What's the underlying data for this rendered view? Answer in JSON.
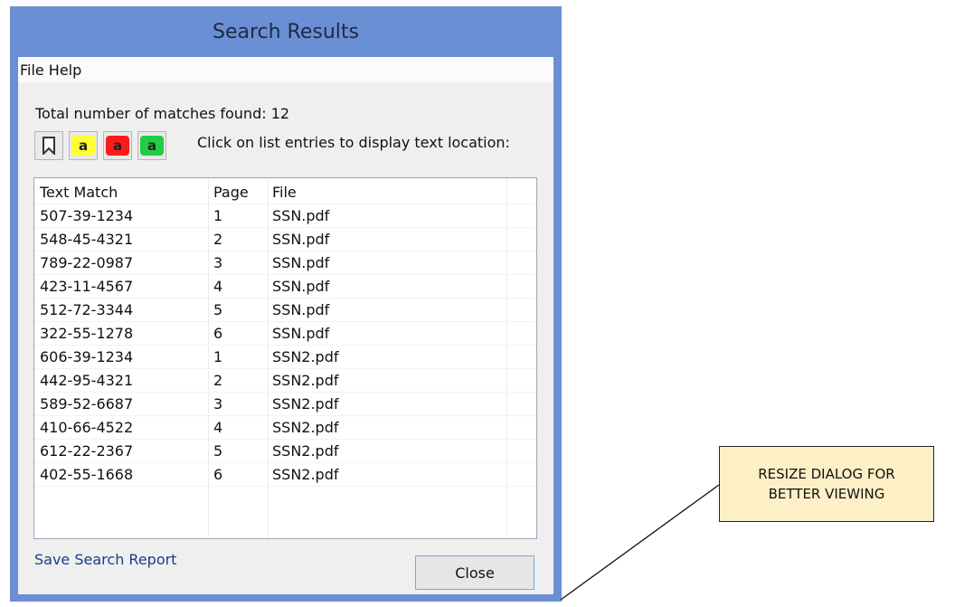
{
  "dialog": {
    "title": "Search Results",
    "menu": [
      "File",
      "Help"
    ],
    "summary": "Total number of matches found: 12",
    "hint": "Click on list entries to display text location:",
    "toolbar": {
      "highlight_letter": "a",
      "yellow": "#ffff33",
      "red": "#ff1a1a",
      "green": "#22cc44"
    },
    "columns": [
      "Text Match",
      "Page",
      "File"
    ],
    "rows": [
      [
        "507-39-1234",
        "1",
        "SSN.pdf"
      ],
      [
        "548-45-4321",
        "2",
        "SSN.pdf"
      ],
      [
        "789-22-0987",
        "3",
        "SSN.pdf"
      ],
      [
        "423-11-4567",
        "4",
        "SSN.pdf"
      ],
      [
        "512-72-3344",
        "5",
        "SSN.pdf"
      ],
      [
        "322-55-1278",
        "6",
        "SSN.pdf"
      ],
      [
        "606-39-1234",
        "1",
        "SSN2.pdf"
      ],
      [
        "442-95-4321",
        "2",
        "SSN2.pdf"
      ],
      [
        "589-52-6687",
        "3",
        "SSN2.pdf"
      ],
      [
        "410-66-4522",
        "4",
        "SSN2.pdf"
      ],
      [
        "612-22-2367",
        "5",
        "SSN2.pdf"
      ],
      [
        "402-55-1668",
        "6",
        "SSN2.pdf"
      ]
    ],
    "save_link": "Save Search Report",
    "close_button": "Close"
  },
  "callout": {
    "line1": "RESIZE DIALOG FOR",
    "line2": "BETTER VIEWING"
  }
}
